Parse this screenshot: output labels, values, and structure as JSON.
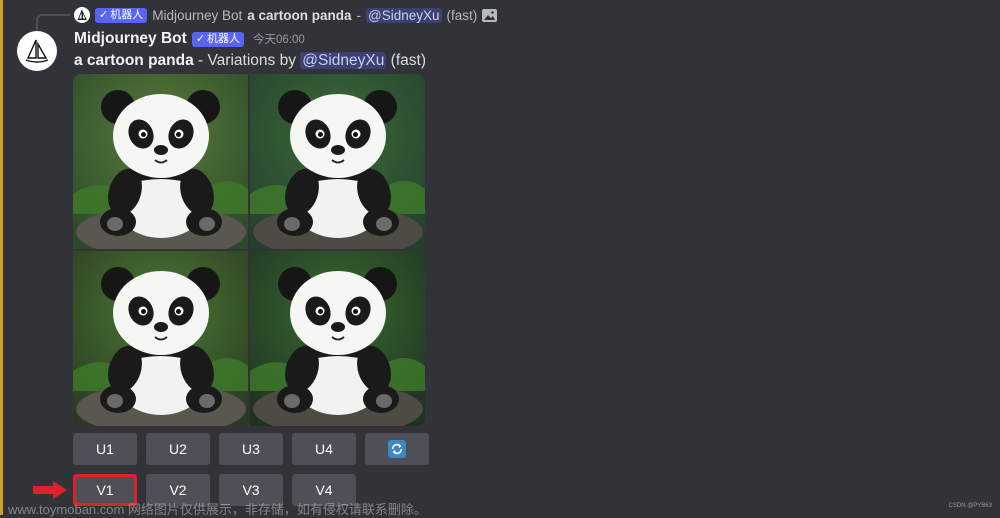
{
  "reply": {
    "bot_badge": "机器人",
    "author": "Midjourney Bot",
    "prompt": "a cartoon panda",
    "separator": "-",
    "mention": "@SidneyXu",
    "mode": "(fast)",
    "attachment_icon": "image-icon"
  },
  "message": {
    "author": "Midjourney Bot",
    "bot_badge": "机器人",
    "timestamp": "今天06:00",
    "prompt": "a cartoon panda",
    "variation_text": " - Variations by ",
    "mention": "@SidneyXu",
    "mode": "(fast)"
  },
  "image_grid": {
    "alt": "a cartoon panda"
  },
  "buttons": {
    "upscale": [
      "U1",
      "U2",
      "U3",
      "U4"
    ],
    "refresh_icon": "refresh-icon",
    "variation": [
      "V1",
      "V2",
      "V3",
      "V4"
    ],
    "highlighted": "V1"
  },
  "colors": {
    "background": "#313338",
    "button": "#4e5058",
    "badge": "#5865f2",
    "highlight": "#e0202a",
    "accent_bar": "#c9a227"
  },
  "watermark": "www.toymoban.com 网络图片仅供展示，非存储，如有侵权请联系删除。",
  "corner_mark": "CSDN @PYB63"
}
